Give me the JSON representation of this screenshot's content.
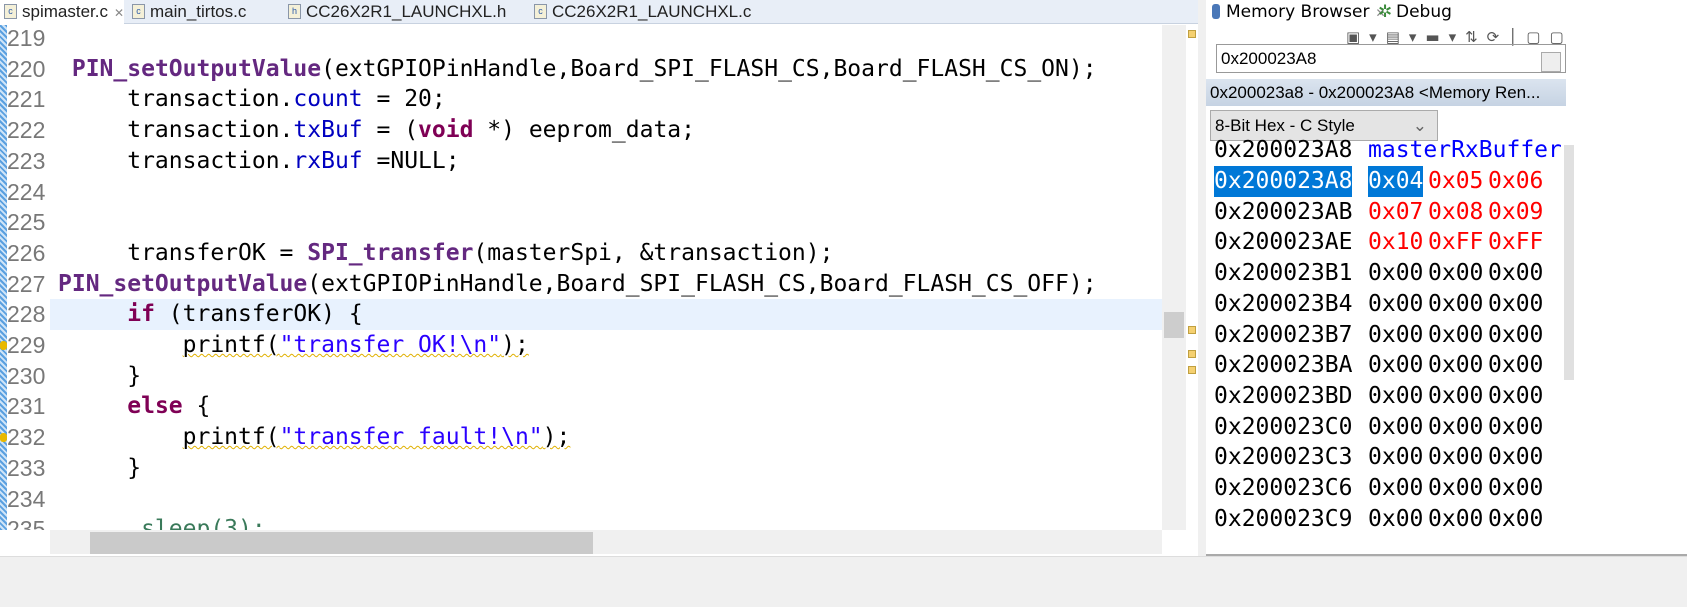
{
  "editor": {
    "tabs": [
      {
        "label": "spimaster.c",
        "icon": "c-file-icon",
        "active": true
      },
      {
        "label": "main_tirtos.c",
        "icon": "c-file-icon"
      },
      {
        "label": "CC26X2R1_LAUNCHXL.h",
        "icon": "h-file-icon"
      },
      {
        "label": "CC26X2R1_LAUNCHXL.c",
        "icon": "c-file-icon"
      }
    ],
    "current_line": 228,
    "lines": [
      {
        "n": "219",
        "segs": []
      },
      {
        "n": "220",
        "segs": [
          {
            "t": " "
          },
          {
            "t": "PIN_setOutputValue",
            "c": "fn"
          },
          {
            "t": "(extGPIOPinHandle,Board_SPI_FLASH_CS,Board_FLASH_CS_ON);"
          }
        ]
      },
      {
        "n": "221",
        "segs": [
          {
            "t": "     transaction."
          },
          {
            "t": "count",
            "c": "fld"
          },
          {
            "t": " = 20;"
          }
        ]
      },
      {
        "n": "222",
        "segs": [
          {
            "t": "     transaction."
          },
          {
            "t": "txBuf",
            "c": "fld"
          },
          {
            "t": " = ("
          },
          {
            "t": "void",
            "c": "kw"
          },
          {
            "t": " *) eeprom_data;"
          }
        ]
      },
      {
        "n": "223",
        "segs": [
          {
            "t": "     transaction."
          },
          {
            "t": "rxBuf",
            "c": "fld"
          },
          {
            "t": " =NULL;"
          }
        ]
      },
      {
        "n": "224",
        "segs": []
      },
      {
        "n": "225",
        "segs": []
      },
      {
        "n": "226",
        "segs": [
          {
            "t": "     transferOK = "
          },
          {
            "t": "SPI_transfer",
            "c": "fn"
          },
          {
            "t": "(masterSpi, &transaction);"
          }
        ]
      },
      {
        "n": "227",
        "segs": [
          {
            "t": "PIN_setOutputValue",
            "c": "fn"
          },
          {
            "t": "(extGPIOPinHandle,Board_SPI_FLASH_CS,Board_FLASH_CS_OFF);"
          }
        ]
      },
      {
        "n": "228",
        "segs": [
          {
            "t": "     "
          },
          {
            "t": "if",
            "c": "kw"
          },
          {
            "t": " (transferOK) {"
          }
        ]
      },
      {
        "n": "229",
        "warn": true,
        "segs": [
          {
            "t": "         "
          },
          {
            "t": "printf(",
            "c": "sq"
          },
          {
            "t": "\"transfer OK!\\n\"",
            "c": "str sq"
          },
          {
            "t": ");",
            "c": "sq"
          }
        ]
      },
      {
        "n": "230",
        "segs": [
          {
            "t": "     }"
          }
        ]
      },
      {
        "n": "231",
        "segs": [
          {
            "t": "     "
          },
          {
            "t": "else",
            "c": "kw"
          },
          {
            "t": " {"
          }
        ]
      },
      {
        "n": "232",
        "warn": true,
        "segs": [
          {
            "t": "         "
          },
          {
            "t": "printf(",
            "c": "sq"
          },
          {
            "t": "\"transfer fault!\\n\"",
            "c": "str sq"
          },
          {
            "t": ");",
            "c": "sq"
          }
        ]
      },
      {
        "n": "233",
        "segs": [
          {
            "t": "     }"
          }
        ]
      },
      {
        "n": "234",
        "segs": []
      },
      {
        "n": "235",
        "segs": [
          {
            "t": "      sleep(3);",
            "c": "gr"
          }
        ]
      }
    ]
  },
  "memory_browser": {
    "tab_label": "Memory Browser",
    "debug_tab_label": "Debug",
    "address_input": "0x200023A8",
    "rendering_title": "0x200023a8 - 0x200023A8 <Memory Ren...",
    "format": "8-Bit Hex - C Style",
    "header": {
      "addr": "0x200023A8",
      "symbol": "masterRxBuffer"
    },
    "rows": [
      {
        "addr": "0x200023A8",
        "vals": [
          "0x04",
          "0x05",
          "0x06"
        ],
        "sel": true,
        "changed": [
          false,
          true,
          true
        ]
      },
      {
        "addr": "0x200023AB",
        "vals": [
          "0x07",
          "0x08",
          "0x09"
        ],
        "changed": [
          true,
          true,
          true
        ]
      },
      {
        "addr": "0x200023AE",
        "vals": [
          "0x10",
          "0xFF",
          "0xFF"
        ],
        "changed": [
          true,
          true,
          true
        ]
      },
      {
        "addr": "0x200023B1",
        "vals": [
          "0x00",
          "0x00",
          "0x00"
        ]
      },
      {
        "addr": "0x200023B4",
        "vals": [
          "0x00",
          "0x00",
          "0x00"
        ]
      },
      {
        "addr": "0x200023B7",
        "vals": [
          "0x00",
          "0x00",
          "0x00"
        ]
      },
      {
        "addr": "0x200023BA",
        "vals": [
          "0x00",
          "0x00",
          "0x00"
        ]
      },
      {
        "addr": "0x200023BD",
        "vals": [
          "0x00",
          "0x00",
          "0x00"
        ]
      },
      {
        "addr": "0x200023C0",
        "vals": [
          "0x00",
          "0x00",
          "0x00"
        ]
      },
      {
        "addr": "0x200023C3",
        "vals": [
          "0x00",
          "0x00",
          "0x00"
        ]
      },
      {
        "addr": "0x200023C6",
        "vals": [
          "0x00",
          "0x00",
          "0x00"
        ]
      },
      {
        "addr": "0x200023C9",
        "vals": [
          "0x00",
          "0x00",
          "0x00"
        ]
      }
    ]
  }
}
